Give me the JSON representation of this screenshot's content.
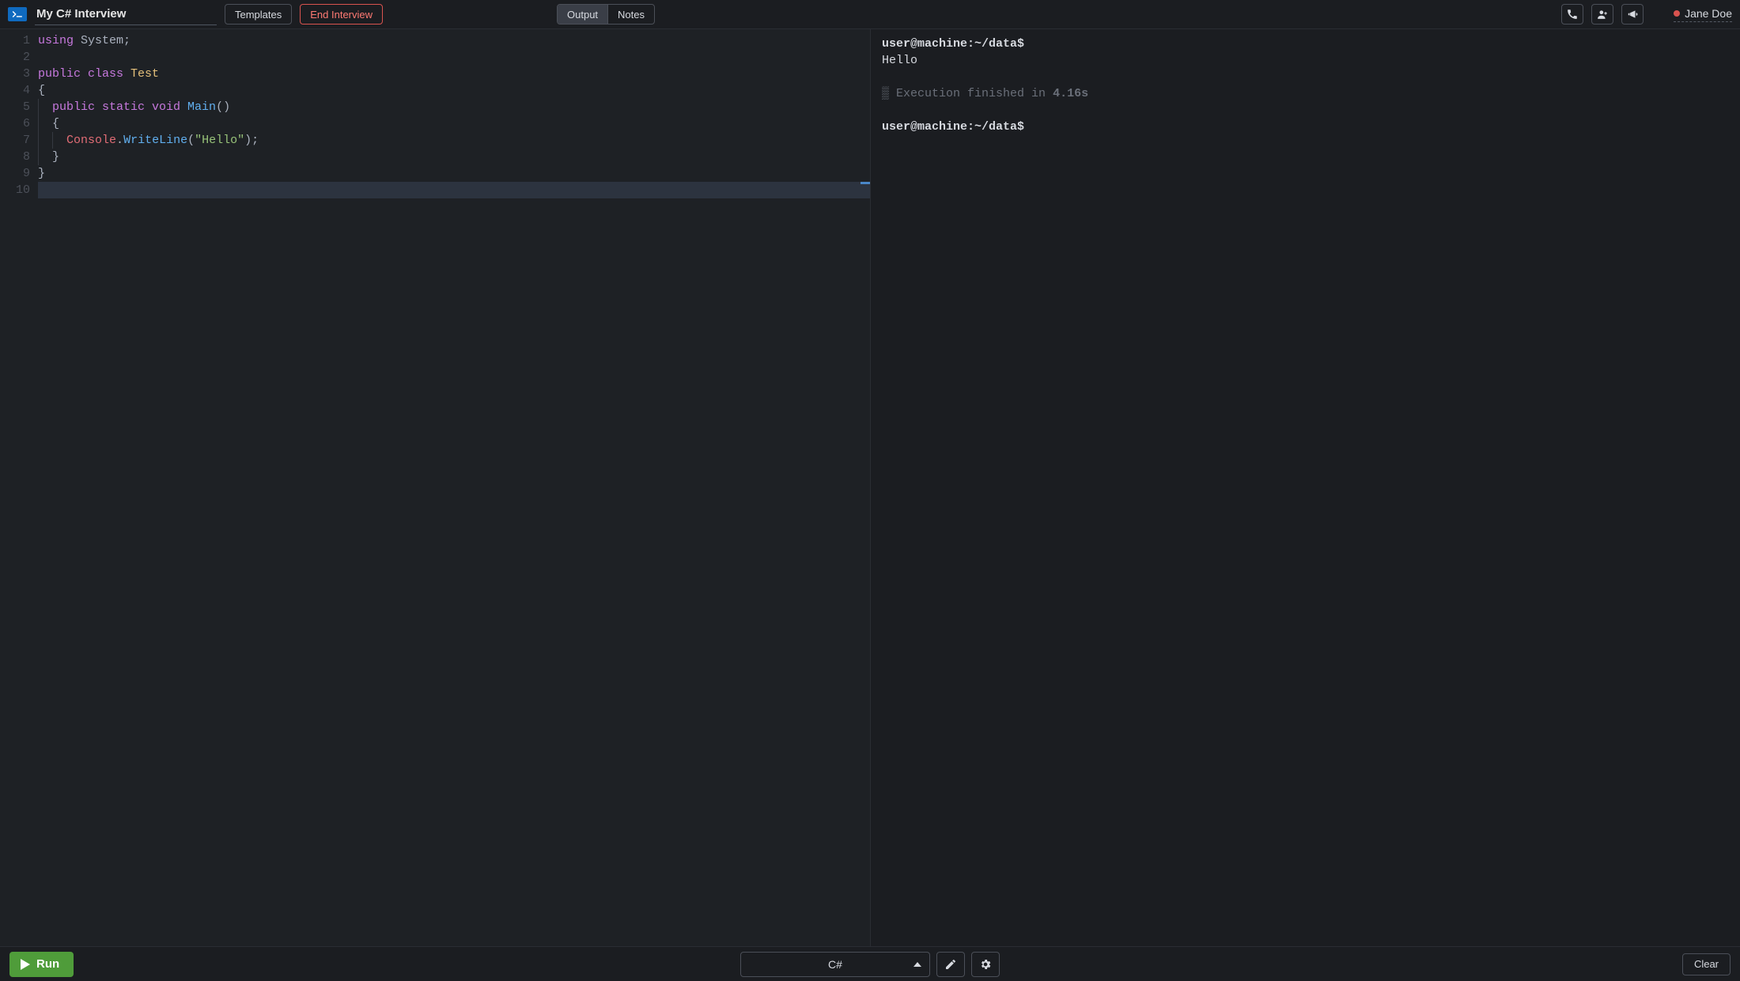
{
  "header": {
    "title": "My C# Interview",
    "templates_label": "Templates",
    "end_interview_label": "End Interview",
    "output_tab": "Output",
    "notes_tab": "Notes",
    "user_name": "Jane Doe"
  },
  "editor": {
    "line_count": 10,
    "tokens": [
      [
        {
          "t": "using ",
          "c": "kw"
        },
        {
          "t": "System",
          "c": "pln"
        },
        {
          "t": ";",
          "c": "punc"
        }
      ],
      [],
      [
        {
          "t": "public class ",
          "c": "kw"
        },
        {
          "t": "Test",
          "c": "cls"
        }
      ],
      [
        {
          "t": "{",
          "c": "punc"
        }
      ],
      [
        {
          "t": "  ",
          "c": "pln",
          "guide": 1
        },
        {
          "t": "public static void ",
          "c": "kw"
        },
        {
          "t": "Main",
          "c": "fn"
        },
        {
          "t": "()",
          "c": "pln"
        }
      ],
      [
        {
          "t": "  ",
          "c": "pln",
          "guide": 1
        },
        {
          "t": "{",
          "c": "punc"
        }
      ],
      [
        {
          "t": "  ",
          "c": "pln",
          "guide": 1
        },
        {
          "t": "  ",
          "c": "pln",
          "guide": 1
        },
        {
          "t": "Console",
          "c": "id"
        },
        {
          "t": ".",
          "c": "punc"
        },
        {
          "t": "WriteLine",
          "c": "fn"
        },
        {
          "t": "(",
          "c": "punc"
        },
        {
          "t": "\"Hello\"",
          "c": "str"
        },
        {
          "t": ");",
          "c": "punc"
        }
      ],
      [
        {
          "t": "  ",
          "c": "pln",
          "guide": 1
        },
        {
          "t": "}",
          "c": "punc"
        }
      ],
      [
        {
          "t": "}",
          "c": "punc"
        }
      ],
      []
    ],
    "current_line_index": 9
  },
  "terminal": {
    "prompt": "user@machine:~/data$",
    "lines": [
      {
        "type": "prompt",
        "text": "user@machine:~/data$"
      },
      {
        "type": "out",
        "text": "Hello"
      },
      {
        "type": "blank"
      },
      {
        "type": "status",
        "prefix": "▒",
        "text": " Execution finished in ",
        "bold": "4.16s"
      },
      {
        "type": "blank"
      },
      {
        "type": "prompt",
        "text": "user@machine:~/data$"
      }
    ]
  },
  "bottom": {
    "run_label": "Run",
    "language": "C#",
    "clear_label": "Clear"
  },
  "icons": {
    "logo": "terminal-prompt-icon",
    "phone": "phone-icon",
    "invite": "add-user-icon",
    "megaphone": "megaphone-icon",
    "pencil": "pencil-icon",
    "gear": "gear-icon",
    "play": "play-icon"
  }
}
